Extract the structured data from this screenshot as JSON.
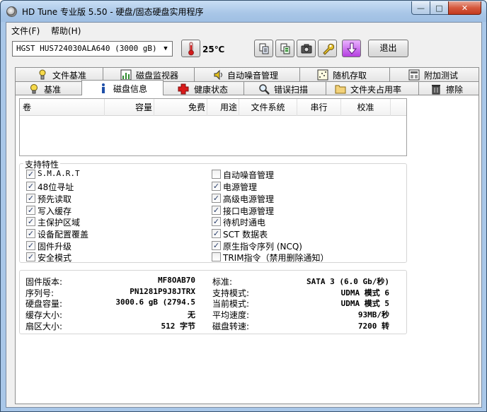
{
  "window": {
    "title": "HD Tune 专业版 5.50 - 硬盘/固态硬盘实用程序",
    "controls": {
      "minimize": "—",
      "maximize": "□",
      "close": "✕"
    }
  },
  "menu": [
    {
      "label": "文件(F)"
    },
    {
      "label": "帮助(H)"
    }
  ],
  "toolbar": {
    "drive": "HGST HUS724030ALA640 (3000 gB)",
    "temperature": "25℃",
    "exit_label": "退出"
  },
  "tabs_top": [
    {
      "label": "文件基准",
      "icon": "document-benchmark-icon"
    },
    {
      "label": "磁盘监视器",
      "icon": "monitor-chart-icon"
    },
    {
      "label": "自动噪音管理",
      "icon": "speaker-icon"
    },
    {
      "label": "随机存取",
      "icon": "random-access-icon"
    },
    {
      "label": "附加测试",
      "icon": "extra-tests-icon"
    }
  ],
  "tabs_bottom": [
    {
      "label": "基准",
      "icon": "lightbulb-icon"
    },
    {
      "label": "磁盘信息",
      "icon": "info-icon",
      "active": true
    },
    {
      "label": "健康状态",
      "icon": "health-cross-icon"
    },
    {
      "label": "错误扫描",
      "icon": "magnifier-icon"
    },
    {
      "label": "文件夹占用率",
      "icon": "folder-icon"
    },
    {
      "label": "擦除",
      "icon": "trash-icon"
    }
  ],
  "volume_table": {
    "headers": [
      "卷",
      "容量",
      "免费",
      "用途",
      "文件系统",
      "串行",
      "校准"
    ],
    "rows": []
  },
  "features": {
    "title": "支持特性",
    "left": [
      {
        "label": "S.M.A.R.T",
        "checked": true
      },
      {
        "label": "48位寻址",
        "checked": true
      },
      {
        "label": "预先读取",
        "checked": true
      },
      {
        "label": "写入缓存",
        "checked": true
      },
      {
        "label": "主保护区域",
        "checked": true
      },
      {
        "label": "设备配置覆盖",
        "checked": true
      },
      {
        "label": "固件升级",
        "checked": true
      },
      {
        "label": "安全模式",
        "checked": true
      }
    ],
    "right": [
      {
        "label": "自动噪音管理",
        "checked": false
      },
      {
        "label": "电源管理",
        "checked": true
      },
      {
        "label": "高级电源管理",
        "checked": true
      },
      {
        "label": "接口电源管理",
        "checked": true
      },
      {
        "label": "待机时通电",
        "checked": true
      },
      {
        "label": "SCT 数据表",
        "checked": true
      },
      {
        "label": "原生指令序列 (NCQ)",
        "checked": true
      },
      {
        "label": "TRIM指令（禁用删除通知）",
        "checked": false
      }
    ]
  },
  "info": {
    "left": [
      {
        "label": "固件版本:",
        "value": "MF8OAB70"
      },
      {
        "label": "序列号:",
        "value": "PN1281P9J8JTRX"
      },
      {
        "label": "硬盘容量:",
        "value": "3000.6 gB (2794.5"
      },
      {
        "label": "缓存大小:",
        "value": "无"
      },
      {
        "label": "扇区大小:",
        "value": "512 字节"
      }
    ],
    "right": [
      {
        "label": "标准:",
        "value": "SATA 3 (6.0 Gb/秒)"
      },
      {
        "label": "支持模式:",
        "value": "UDMA 模式 6"
      },
      {
        "label": "当前模式:",
        "value": "UDMA 模式 5"
      },
      {
        "label": "平均速度:",
        "value": "93MB/秒"
      },
      {
        "label": "磁盘转速:",
        "value": "7200 转"
      }
    ]
  },
  "colors": {
    "titlebar": "#a9c7e8",
    "close_button": "#d6593d",
    "client_bg": "#f0f0f0",
    "panel_bg": "#ffffff"
  }
}
